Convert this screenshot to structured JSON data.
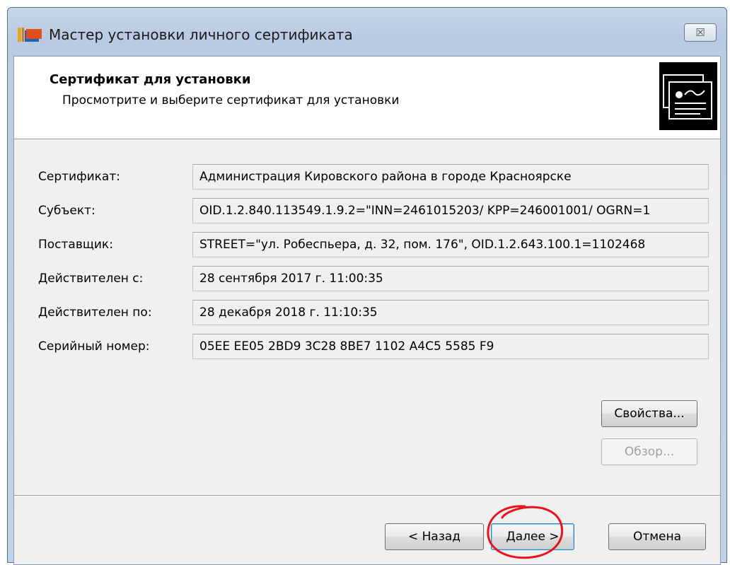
{
  "window": {
    "title": "Мастер установки личного сертификата",
    "close_label": "☒"
  },
  "header": {
    "title": "Сертификат для установки",
    "subtitle": "Просмотрите и выберите сертификат для установки"
  },
  "fields": [
    {
      "label": "Сертификат:",
      "value": "Администрация Кировского района в городе Красноярске"
    },
    {
      "label": "Субъект:",
      "value": "OID.1.2.840.113549.1.9.2=\"INN=2461015203/ KPP=246001001/ OGRN=1"
    },
    {
      "label": "Поставщик:",
      "value": "STREET=\"ул. Робеспьера, д. 32, пом. 176\", OID.1.2.643.100.1=1102468"
    },
    {
      "label": "Действителен с:",
      "value": "28 сентября 2017 г. 11:00:35"
    },
    {
      "label": "Действителен по:",
      "value": "28 декабря 2018 г. 11:10:35"
    },
    {
      "label": "Серийный номер:",
      "value": "05EE EE05 2BD9 3C28 8BE7 1102 A4C5 5585 F9"
    }
  ],
  "buttons": {
    "properties": "Свойства...",
    "browse": "Обзор...",
    "back": "< Назад",
    "next": "Далее >",
    "cancel": "Отмена"
  },
  "colors": {
    "annotation_circle": "#e8141b",
    "window_frame": "#c3d3e7"
  }
}
